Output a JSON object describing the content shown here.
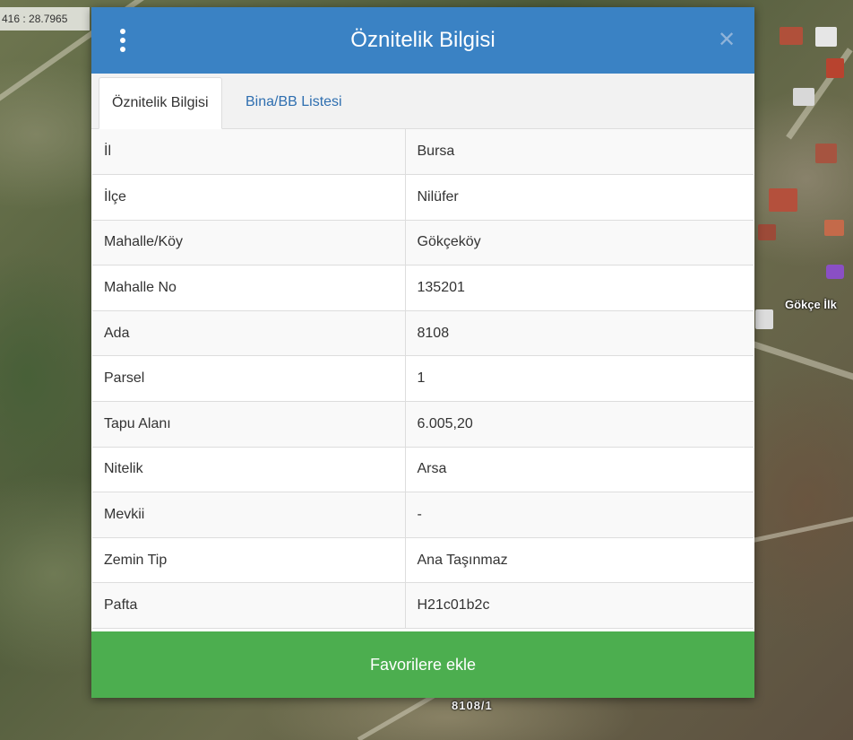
{
  "map": {
    "coordinate_readout": "416 : 28.7965",
    "place_label": "Gökçe İlk",
    "parcel_label": "8108/1"
  },
  "modal": {
    "title": "Öznitelik Bilgisi",
    "menu_icon": "vertical-dots-icon",
    "close_icon": "close-icon",
    "close_glyph": "✕",
    "tabs": [
      {
        "label": "Öznitelik Bilgisi",
        "active": true
      },
      {
        "label": "Bina/BB Listesi",
        "active": false
      }
    ],
    "rows": [
      {
        "key": "İl",
        "value": "Bursa"
      },
      {
        "key": "İlçe",
        "value": "Nilüfer"
      },
      {
        "key": "Mahalle/Köy",
        "value": "Gökçeköy"
      },
      {
        "key": "Mahalle No",
        "value": "135201"
      },
      {
        "key": "Ada",
        "value": "8108"
      },
      {
        "key": "Parsel",
        "value": "1"
      },
      {
        "key": "Tapu Alanı",
        "value": "6.005,20"
      },
      {
        "key": "Nitelik",
        "value": "Arsa"
      },
      {
        "key": "Mevkii",
        "value": "-"
      },
      {
        "key": "Zemin Tip",
        "value": "Ana Taşınmaz"
      },
      {
        "key": "Pafta",
        "value": "H21c01b2c"
      }
    ],
    "favorite_button_label": "Favorilere ekle"
  },
  "colors": {
    "header": "#3a82c4",
    "tab_link": "#2f6fb0",
    "favorite_button": "#4cae4f"
  }
}
